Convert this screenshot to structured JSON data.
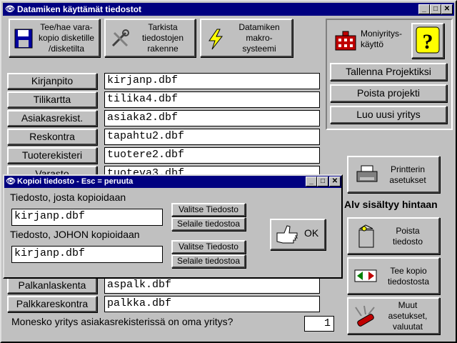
{
  "main_window": {
    "title": "Datamiken käyttämät tiedostot",
    "minimize": "_",
    "maximize": "□",
    "close": "✕"
  },
  "toolbar": {
    "copy_disk": [
      "Tee/hae vara-",
      "kopio disketille",
      "/disketilta"
    ],
    "check_struct": [
      "Tarkista",
      "tiedostojen",
      "rakenne"
    ],
    "macro": [
      "Datamiken",
      "makro-",
      "systeemi"
    ]
  },
  "multi_company": {
    "label": [
      "Moniyritys-",
      "käyttö"
    ],
    "help_icon": "question-icon"
  },
  "project_buttons": {
    "save": "Tallenna Projektiksi",
    "delete": "Poista projekti",
    "new_company": "Luo uusi yritys"
  },
  "files": [
    {
      "name": "Kirjanpito",
      "file": "kirjanp.dbf"
    },
    {
      "name": "Tilikartta",
      "file": "tilika4.dbf"
    },
    {
      "name": "Asiakasrekist.",
      "file": "asiaka2.dbf"
    },
    {
      "name": "Reskontra",
      "file": "tapahtu2.dbf"
    },
    {
      "name": "Tuoterekisteri",
      "file": "tuotere2.dbf"
    },
    {
      "name": "Varasto",
      "file": "tuoteva3.dbf"
    },
    {
      "name": "Palkanlaskenta",
      "file": "aspalk.dbf"
    },
    {
      "name": "Palkkareskontra",
      "file": "palkka.dbf"
    }
  ],
  "printer": [
    "Printterin",
    "asetukset"
  ],
  "vat_label": "Alv sisältyy hintaan",
  "delete_file": [
    "Poista",
    "tiedosto"
  ],
  "copy_file": [
    "Tee kopio",
    "tiedostosta"
  ],
  "other_settings": [
    "Muut",
    "asetukset,",
    "valuutat"
  ],
  "company_question": "Monesko yritys asiakasrekisterissä on oma yritys?",
  "company_number": "1",
  "dialog": {
    "title": "Kopioi tiedosto - Esc = peruuta",
    "source_label": "Tiedosto, josta kopioidaan",
    "source_value": "kirjanp.dbf",
    "target_label": "Tiedosto, JOHON kopioidaan",
    "target_value": "kirjanp.dbf",
    "select_file": "Valitse Tiedosto",
    "browse_file": "Selaile tiedostoa",
    "ok": "OK"
  }
}
